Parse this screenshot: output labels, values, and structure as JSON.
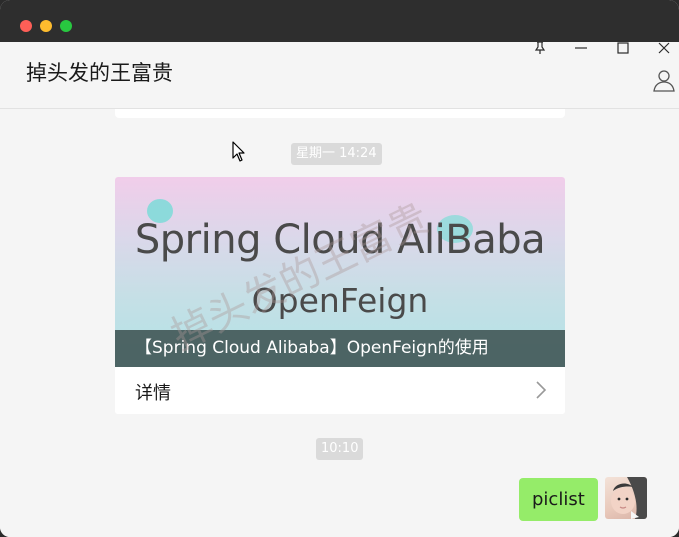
{
  "window": {
    "traffic_lights": [
      "close",
      "minimize",
      "zoom"
    ],
    "colors": {
      "red": "#fe5f57",
      "yellow": "#febc2e",
      "green": "#28c840"
    }
  },
  "header": {
    "title": "掉头发的王富贵",
    "controls": [
      "pin-icon",
      "minimize-icon",
      "maximize-icon",
      "close-icon"
    ],
    "profile_icon": "user-icon"
  },
  "chat": {
    "timestamps": [
      "星期一 14:24",
      "10:10"
    ],
    "article": {
      "cover_line1": "Spring Cloud AliBaba",
      "cover_line2": "OpenFeign",
      "title": "【Spring Cloud Alibaba】OpenFeign的使用",
      "details_label": "详情",
      "watermark": "掉头发的王富贵"
    },
    "outgoing_message": {
      "text": "piclist",
      "bubble_color": "#95ec69"
    }
  }
}
